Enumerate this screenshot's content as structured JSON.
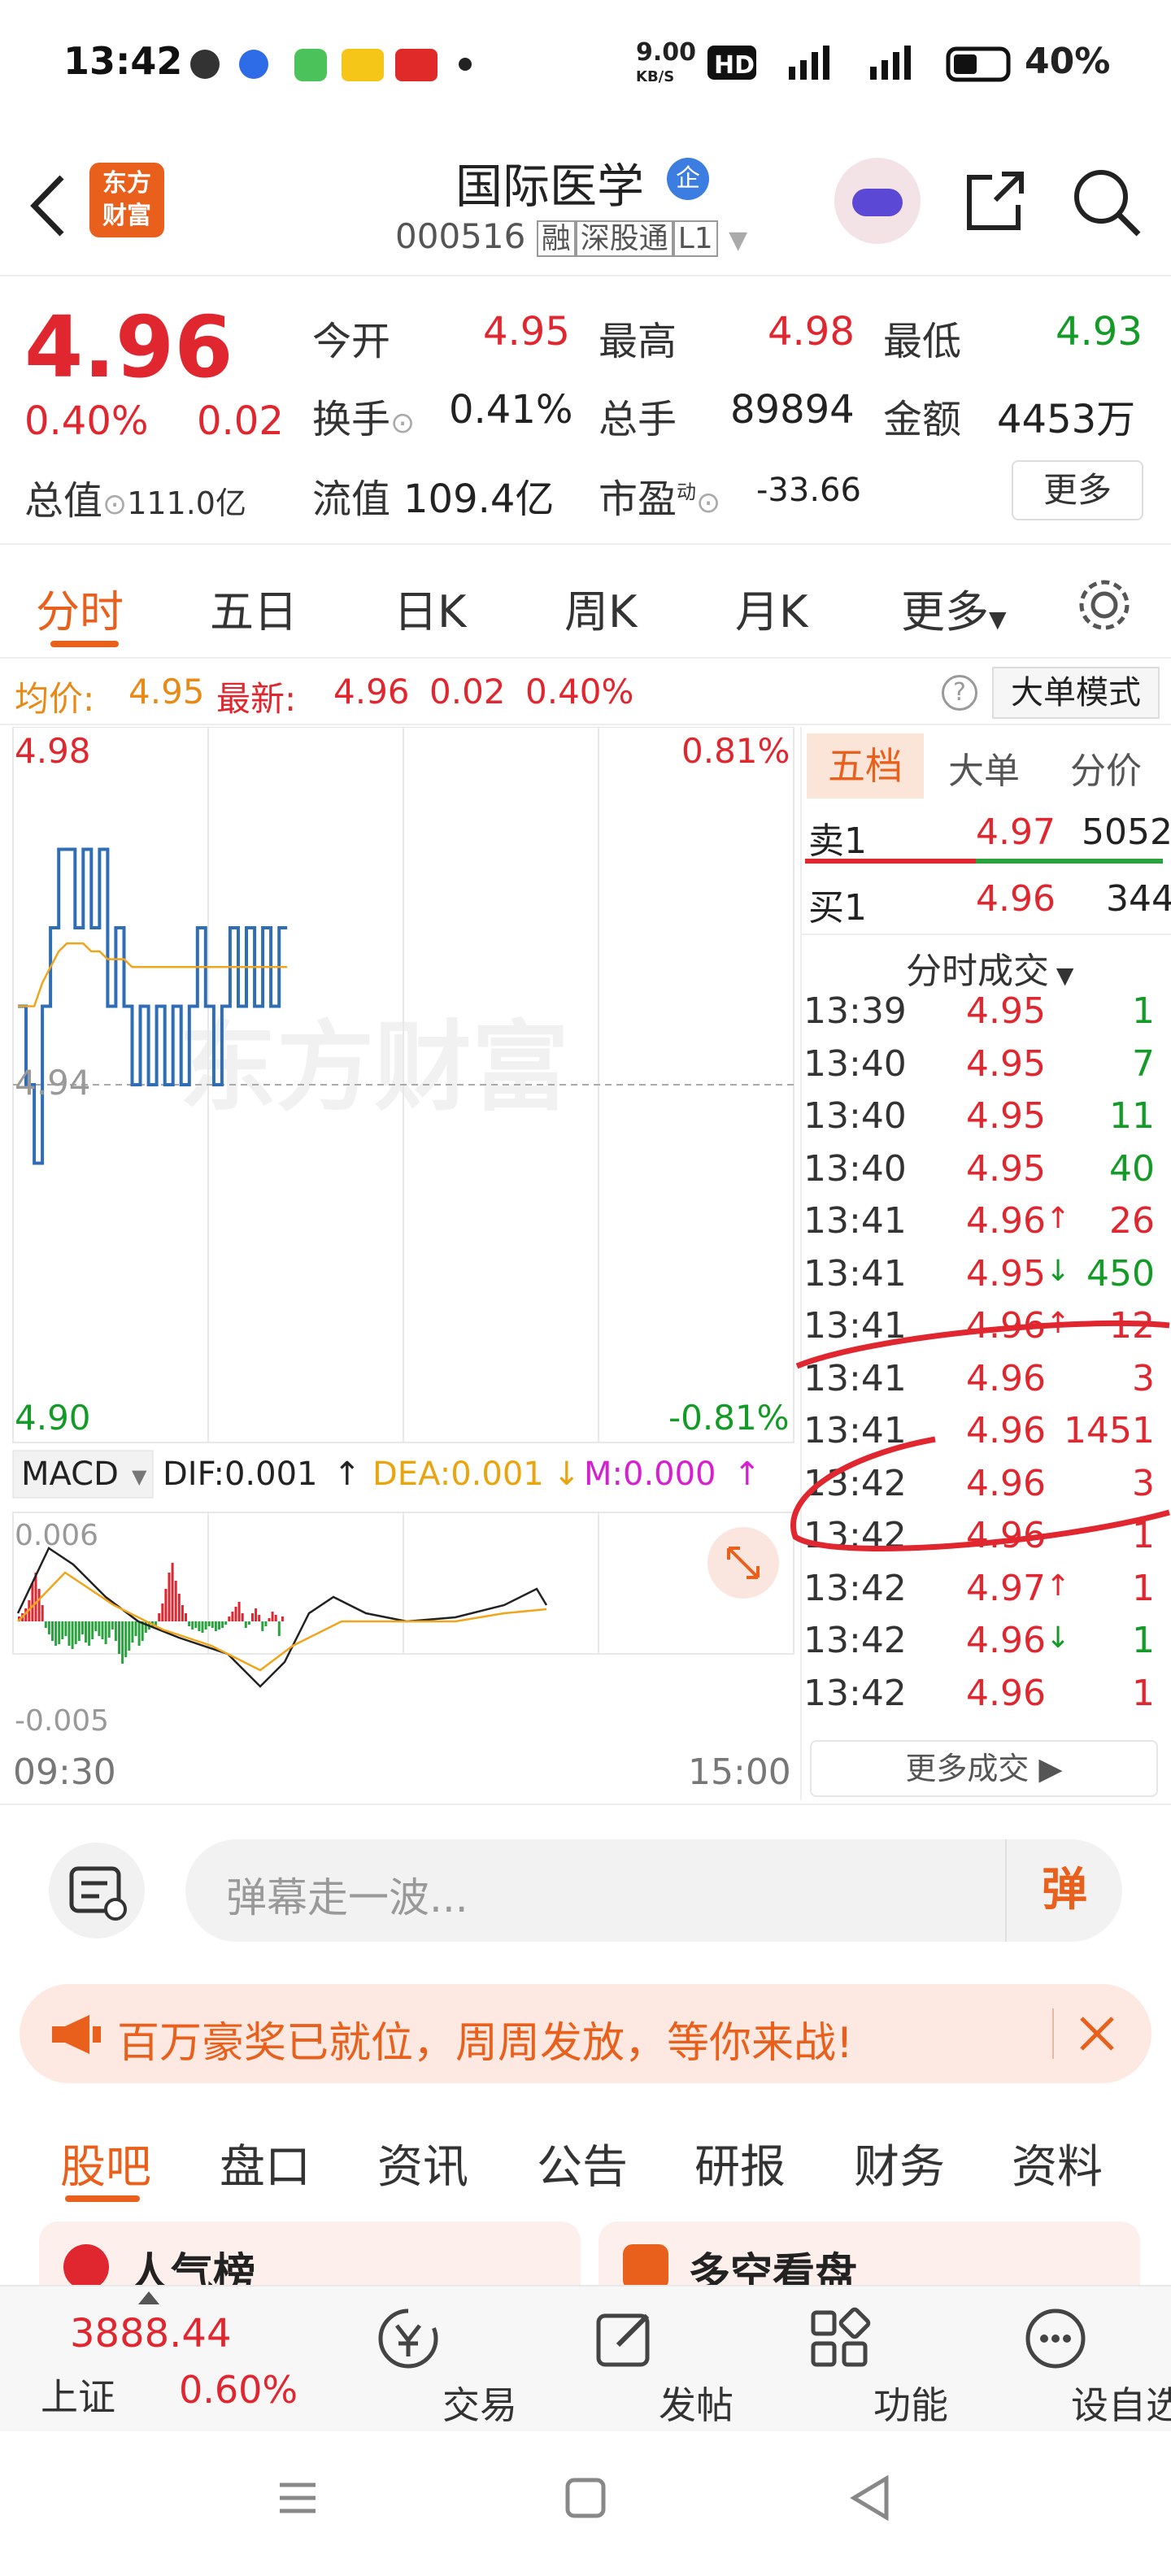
{
  "status_bar": {
    "time": "13:42",
    "net_speed": "9.00",
    "net_unit": "KB/S",
    "battery": "40%"
  },
  "header": {
    "title": "国际医学",
    "code": "000516",
    "tags": [
      "融",
      "深股通",
      "L1"
    ],
    "logo_line1": "东方",
    "logo_line2": "财富",
    "badge": "企"
  },
  "quote": {
    "price": "4.96",
    "pct": "0.40%",
    "chg": "0.02",
    "open_label": "今开",
    "open": "4.95",
    "high_label": "最高",
    "high": "4.98",
    "low_label": "最低",
    "low": "4.93",
    "turnover_label": "换手",
    "turnover": "0.41%",
    "volume_label": "总手",
    "volume": "89894",
    "amount_label": "金额",
    "amount": "4453万",
    "mcap_label": "总值",
    "mcap": "111.0亿",
    "float_label": "流值",
    "float": "109.4亿",
    "pe_label": "市盈",
    "pe_sup": "动",
    "pe": "-33.66",
    "more_btn": "更多"
  },
  "tabs": [
    "分时",
    "五日",
    "日K",
    "周K",
    "月K",
    "更多"
  ],
  "info_bar": {
    "avg_label": "均价:",
    "avg": "4.95",
    "latest_label": "最新:",
    "latest": "4.96",
    "chg": "0.02",
    "pct": "0.40%",
    "mode_btn": "大单模式",
    "help": "?"
  },
  "chart": {
    "top_price": "4.98",
    "top_pct": "0.81%",
    "mid_price": "4.94",
    "bottom_price": "4.90",
    "bottom_pct": "-0.81%",
    "macd_label": "MACD",
    "dif": "DIF:0.001",
    "dea": "DEA:0.001",
    "m": "M:0.000",
    "macd_top": "0.006",
    "macd_bottom": "-0.005",
    "x_start": "09:30",
    "x_end": "15:00",
    "watermark": "东方财富"
  },
  "chart_data": {
    "type": "line",
    "title": "",
    "x_range": [
      "09:30",
      "15:00"
    ],
    "ylim": [
      4.9,
      4.98
    ],
    "series": [
      {
        "name": "price",
        "values": [
          4.95,
          4.94,
          4.93,
          4.95,
          4.96,
          4.97,
          4.97,
          4.96,
          4.97,
          4.96,
          4.97,
          4.95,
          4.96,
          4.95,
          4.94,
          4.95,
          4.94,
          4.95,
          4.94,
          4.95,
          4.94,
          4.95,
          4.96,
          4.95,
          4.94,
          4.95,
          4.96,
          4.95,
          4.96,
          4.95,
          4.96,
          4.95,
          4.96,
          4.96
        ]
      },
      {
        "name": "avg",
        "values": [
          4.95,
          4.95,
          4.95,
          4.953,
          4.955,
          4.957,
          4.958,
          4.958,
          4.958,
          4.957,
          4.957,
          4.956,
          4.956,
          4.956,
          4.955,
          4.955,
          4.955,
          4.955,
          4.955,
          4.955,
          4.955,
          4.955,
          4.955,
          4.955,
          4.955,
          4.955,
          4.955,
          4.955,
          4.955,
          4.955,
          4.955,
          4.955,
          4.955,
          4.955
        ]
      }
    ]
  },
  "side_tabs": [
    "五档",
    "大单",
    "分价"
  ],
  "order_book": [
    {
      "label": "卖1",
      "price": "4.97",
      "vol": "5052"
    },
    {
      "label": "买1",
      "price": "4.96",
      "vol": "344"
    }
  ],
  "trades_title": "分时成交",
  "trades": [
    {
      "t": "13:39",
      "p": "4.95",
      "v": "1",
      "a": ""
    },
    {
      "t": "13:40",
      "p": "4.95",
      "v": "7",
      "a": ""
    },
    {
      "t": "13:40",
      "p": "4.95",
      "v": "11",
      "a": ""
    },
    {
      "t": "13:40",
      "p": "4.95",
      "v": "40",
      "a": ""
    },
    {
      "t": "13:41",
      "p": "4.96",
      "v": "26",
      "a": "↑"
    },
    {
      "t": "13:41",
      "p": "4.95",
      "v": "450",
      "a": "↓"
    },
    {
      "t": "13:41",
      "p": "4.96",
      "v": "12",
      "a": "↑"
    },
    {
      "t": "13:41",
      "p": "4.96",
      "v": "3",
      "a": ""
    },
    {
      "t": "13:41",
      "p": "4.96",
      "v": "1451",
      "a": ""
    },
    {
      "t": "13:42",
      "p": "4.96",
      "v": "3",
      "a": ""
    },
    {
      "t": "13:42",
      "p": "4.96",
      "v": "1",
      "a": ""
    },
    {
      "t": "13:42",
      "p": "4.97",
      "v": "1",
      "a": "↑"
    },
    {
      "t": "13:42",
      "p": "4.96",
      "v": "1",
      "a": "↓"
    },
    {
      "t": "13:42",
      "p": "4.96",
      "v": "1",
      "a": ""
    }
  ],
  "more_trades": "更多成交",
  "comment": {
    "placeholder": "弹幕走一波...",
    "send": "弹"
  },
  "banner": {
    "text": "百万豪奖已就位，周周发放，等你来战!"
  },
  "section_tabs": [
    "股吧",
    "盘口",
    "资讯",
    "公告",
    "研报",
    "财务",
    "资料"
  ],
  "cards": [
    "人气榜",
    "多空看盘"
  ],
  "bottom_nav": {
    "index_value": "3888.44",
    "index_name": "上证",
    "index_pct": "0.60%",
    "items": [
      "交易",
      "发帖",
      "功能",
      "设自选"
    ]
  }
}
